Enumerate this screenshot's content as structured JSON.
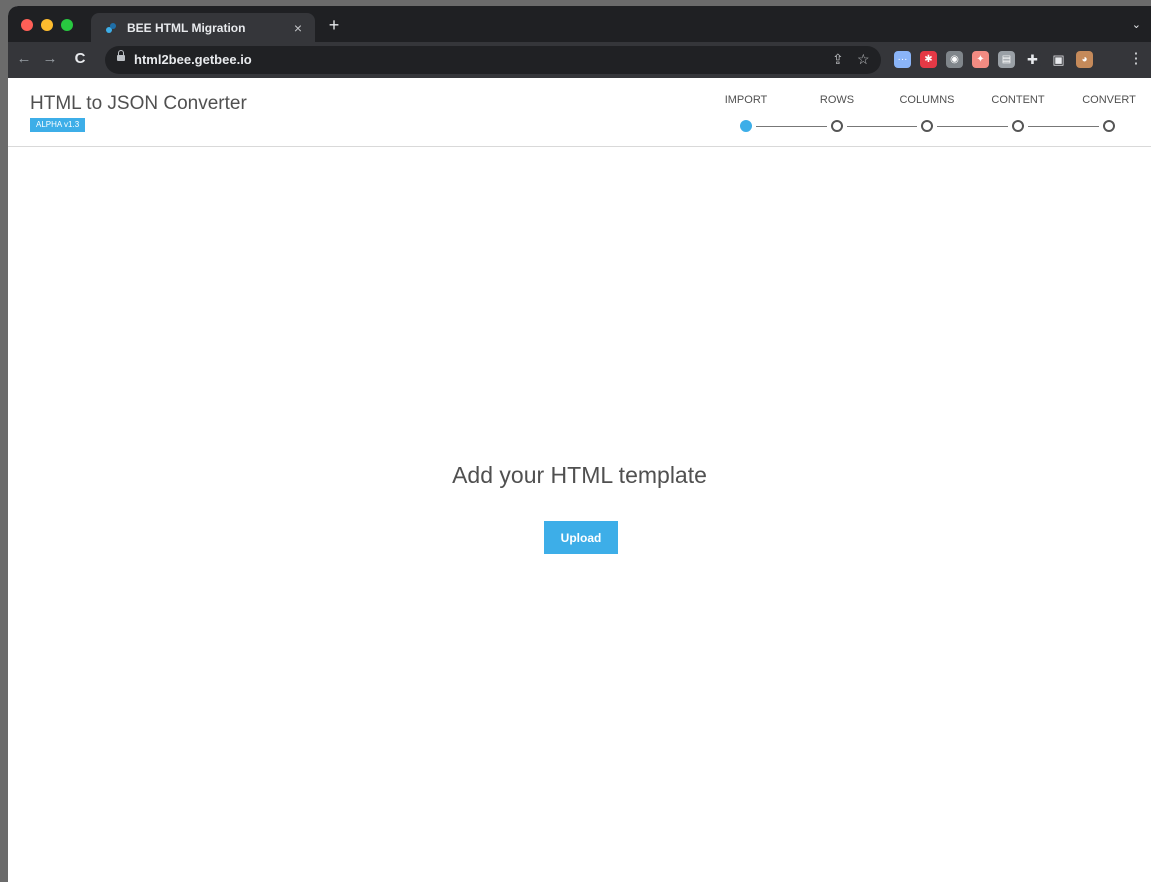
{
  "browser": {
    "tab_title": "BEE HTML Migration",
    "tab_close": "×",
    "new_tab": "+",
    "tab_list": "⌄",
    "url": "html2bee.getbee.io",
    "back": "←",
    "forward": "→",
    "reload": "C",
    "share": "⇪",
    "bookmark": "☆",
    "menu": "⋮",
    "extensions": [
      {
        "name": "extension-icon-dots",
        "glyph": "···",
        "color": "#8ab4f8"
      },
      {
        "name": "extension-icon-red",
        "glyph": "✱",
        "color": "#e53946"
      },
      {
        "name": "extension-icon-camera",
        "glyph": "◉",
        "color": "#80868b"
      },
      {
        "name": "extension-icon-paint",
        "glyph": "✦",
        "color": "#f28b82"
      },
      {
        "name": "extension-icon-tab",
        "glyph": "▤",
        "color": "#9aa0a6"
      },
      {
        "name": "puzzle-icon",
        "glyph": "✚",
        "color": "#35363a"
      },
      {
        "name": "sidepanel-icon",
        "glyph": "▣",
        "color": "#35363a"
      },
      {
        "name": "avatar",
        "glyph": "◕",
        "color": "#c58a5a"
      }
    ]
  },
  "app": {
    "title": "HTML to JSON Converter",
    "badge": "ALPHA v1.3",
    "accent": "#3daee8"
  },
  "steps": [
    {
      "label": "IMPORT",
      "active": true
    },
    {
      "label": "ROWS",
      "active": false
    },
    {
      "label": "COLUMNS",
      "active": false
    },
    {
      "label": "CONTENT",
      "active": false
    },
    {
      "label": "CONVERT",
      "active": false
    }
  ],
  "main": {
    "heading": "Add your HTML template",
    "upload_label": "Upload"
  }
}
